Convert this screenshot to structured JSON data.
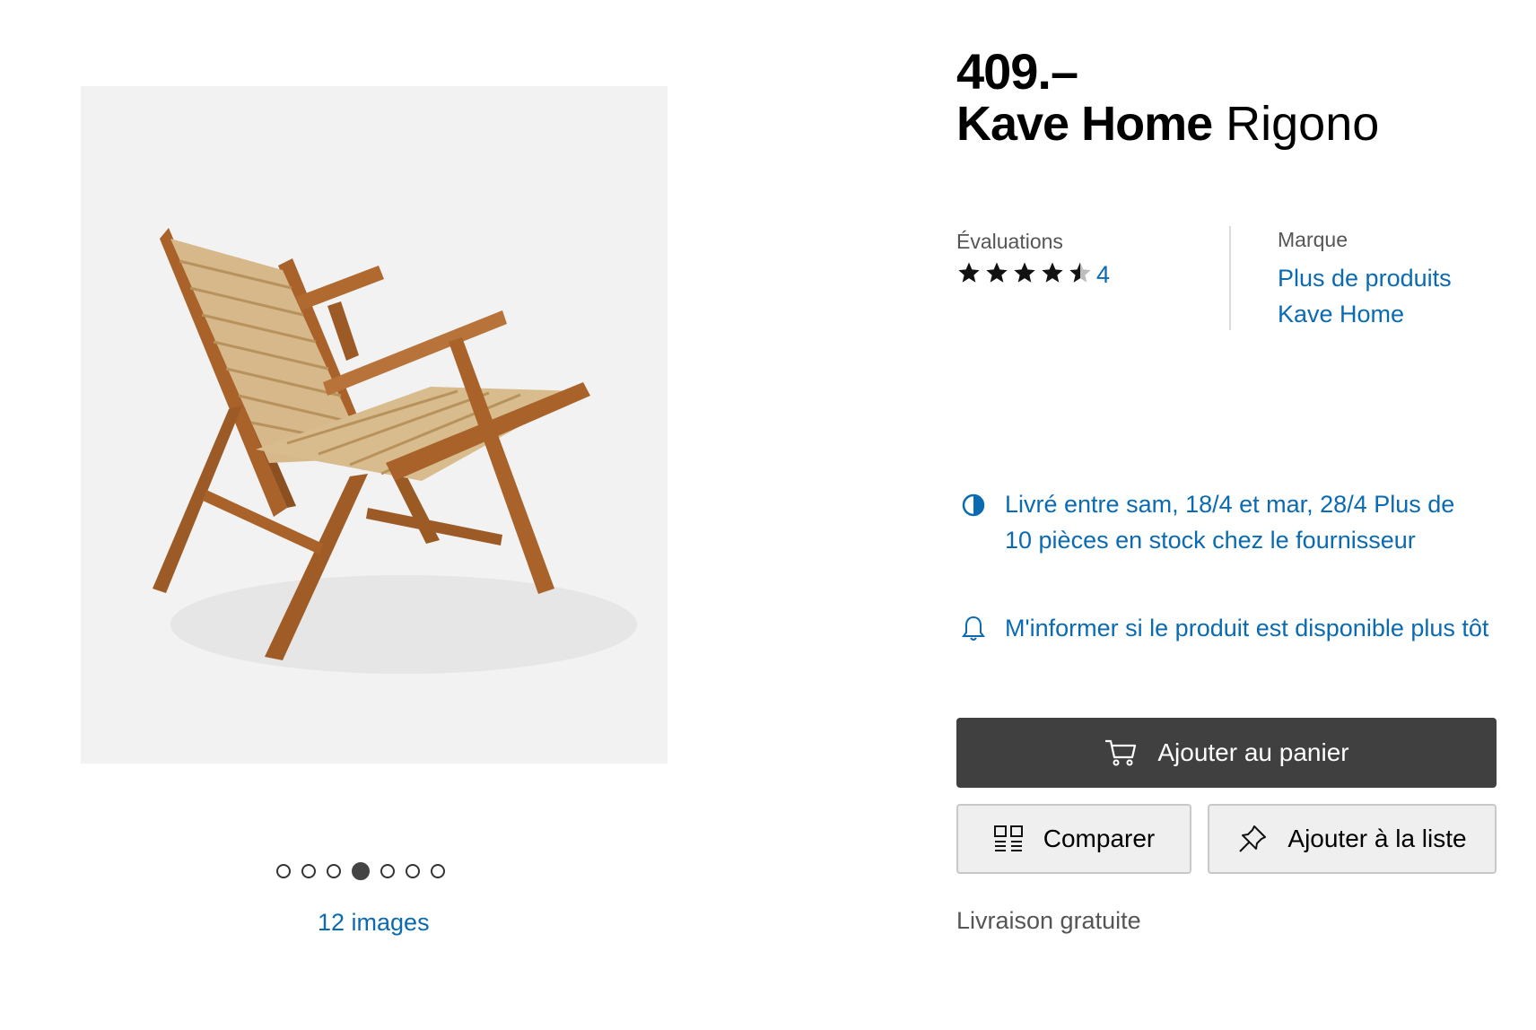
{
  "product": {
    "price": "409.–",
    "brand": "Kave Home",
    "model": "Rigono"
  },
  "gallery": {
    "image_alt": "Kave Home Rigono chair",
    "dot_count": 7,
    "active_dot_index": 3,
    "images_link": "12 images"
  },
  "ratings": {
    "label": "Évaluations",
    "stars_value": 4.5,
    "stars_max": 5,
    "count": "4"
  },
  "brand_info": {
    "label": "Marque",
    "link": "Plus de produits Kave Home"
  },
  "delivery": {
    "icon": "half-circle-icon",
    "text": "Livré entre sam, 18/4 et mar, 28/4 Plus de 10 pièces en stock chez le fournisseur"
  },
  "notify": {
    "icon": "bell-icon",
    "text": "M'informer si le produit est disponible plus tôt"
  },
  "actions": {
    "cart_label": "Ajouter au panier",
    "compare_label": "Comparer",
    "list_label": "Ajouter à la liste"
  },
  "shipping": {
    "text": "Livraison gratuite"
  },
  "colors": {
    "link_blue": "#0a6ab2",
    "cart_button_bg": "#404040",
    "image_bg": "#f2f2f2"
  }
}
